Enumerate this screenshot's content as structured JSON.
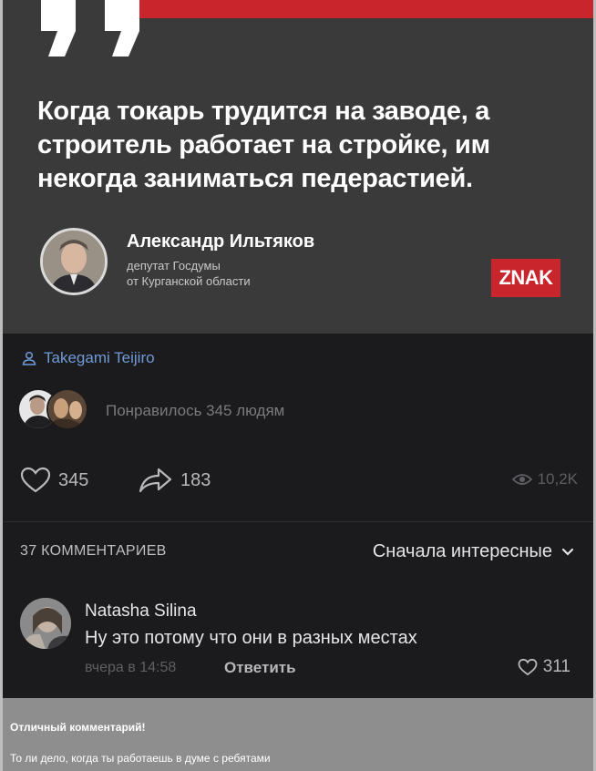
{
  "quote_card": {
    "quote": "Когда токарь трудится на заводе, а строитель работает на стройке, им некогда заниматься педерастией.",
    "author_name": "Александр Ильтяков",
    "author_role_line1": "депутат Госдумы",
    "author_role_line2": "от Курганской области",
    "badge": "ZNAK",
    "colors": {
      "background": "#3a3a3a",
      "accent": "#c8252c"
    }
  },
  "post": {
    "author": "Takegami Teijiro",
    "likes_summary": "Понравилось 345 людям",
    "likes": "345",
    "shares": "183",
    "views": "10,2K",
    "icons": [
      "person-icon",
      "heart-icon",
      "share-icon",
      "eye-icon"
    ],
    "link_color": "#6f9ad6"
  },
  "comments": {
    "header": "37 КОММЕНТАРИЕВ",
    "sort_label": "Сначала интересные",
    "items": [
      {
        "author": "Natasha Silina",
        "text": "Ну это потому что они в разных местах",
        "time": "вчера в 14:58",
        "reply_label": "Ответить",
        "likes": "311"
      }
    ]
  },
  "caption": {
    "title": "Отличный комментарий!",
    "text": "То ли дело, когда ты работаешь в думе с ребятами"
  }
}
